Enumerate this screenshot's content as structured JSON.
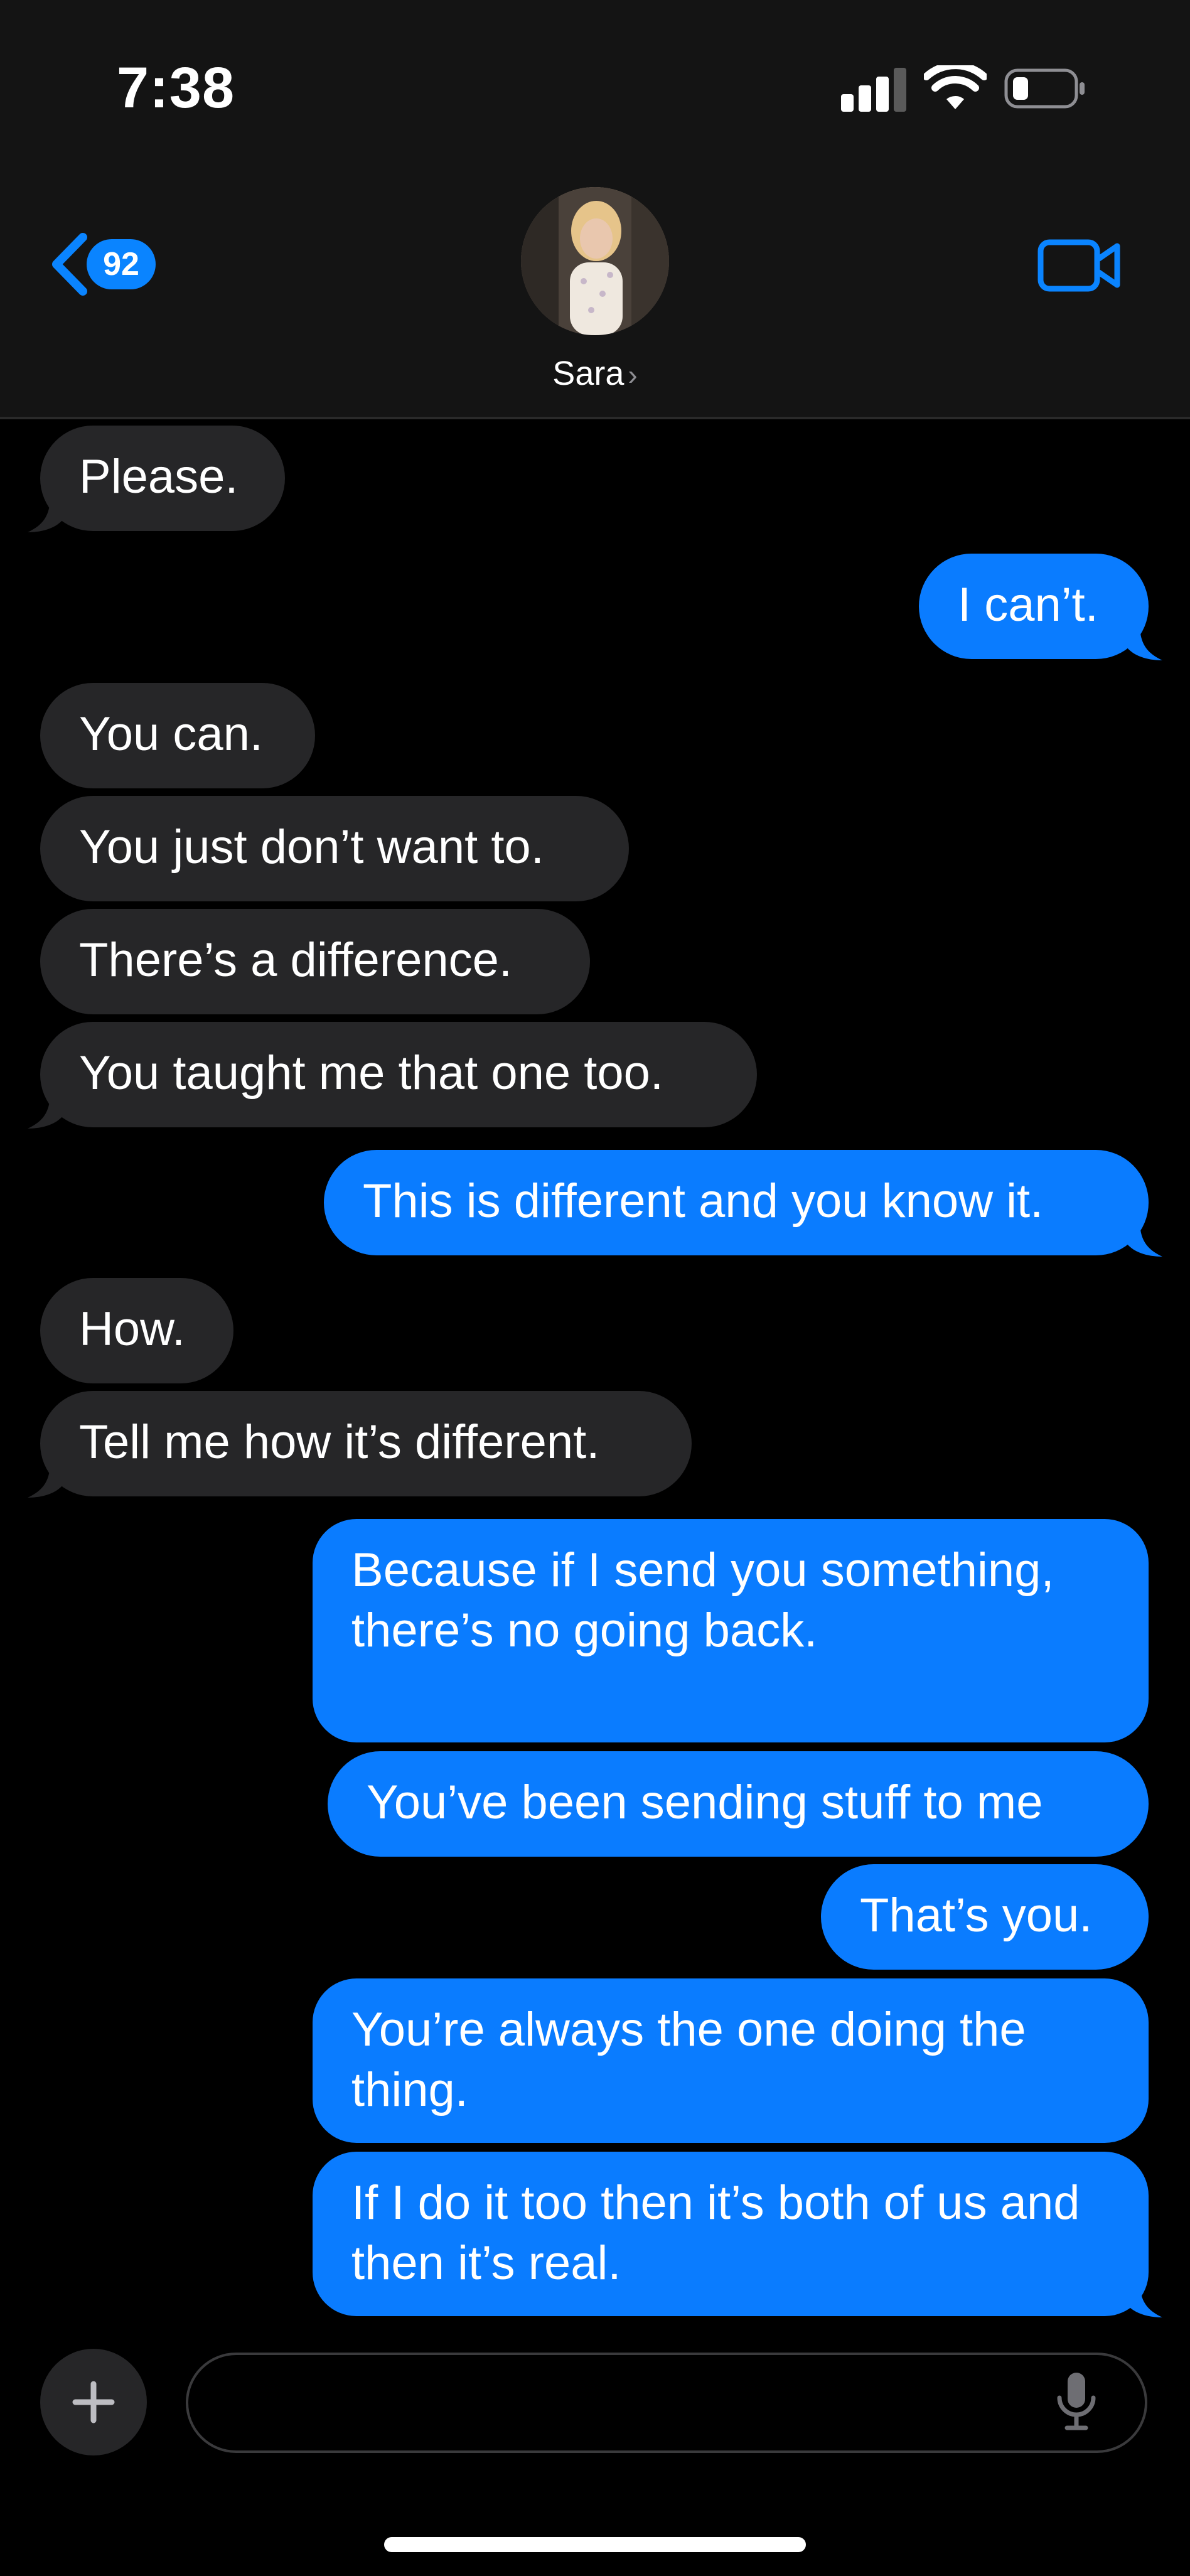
{
  "status_bar": {
    "time": "7:38"
  },
  "header": {
    "back_badge": "92",
    "contact_name": "Sara",
    "chevron": "›"
  },
  "messages": [
    {
      "from": "them",
      "text": "Please."
    },
    {
      "from": "me",
      "text": "I can’t."
    },
    {
      "from": "them",
      "text": "You can."
    },
    {
      "from": "them",
      "text": "You just don’t want to."
    },
    {
      "from": "them",
      "text": "There’s a difference."
    },
    {
      "from": "them",
      "text": "You taught me that one too."
    },
    {
      "from": "me",
      "text": "This is different and you know it."
    },
    {
      "from": "them",
      "text": "How."
    },
    {
      "from": "them",
      "text": "Tell me how it’s different."
    },
    {
      "from": "me",
      "text": "Because if I send you something, there’s no going back."
    },
    {
      "from": "me",
      "text": "You’ve been sending stuff to me"
    },
    {
      "from": "me",
      "text": "That’s you."
    },
    {
      "from": "me",
      "text": "You’re always the one doing the thing."
    },
    {
      "from": "me",
      "text": "If I do it too then it’s both of us and then it’s real."
    }
  ],
  "composer": {
    "placeholder": ""
  },
  "icons": {
    "back": "chevron-left-icon",
    "video": "video-camera-icon",
    "plus": "plus-icon",
    "mic": "microphone-icon",
    "signal": "cellular-signal-icon",
    "wifi": "wifi-icon",
    "battery": "battery-icon"
  },
  "colors": {
    "accent": "#0a84ff",
    "outgoing_bubble": "#0a7cff",
    "incoming_bubble": "#262628",
    "background": "#000000",
    "header_bg": "#141414"
  }
}
